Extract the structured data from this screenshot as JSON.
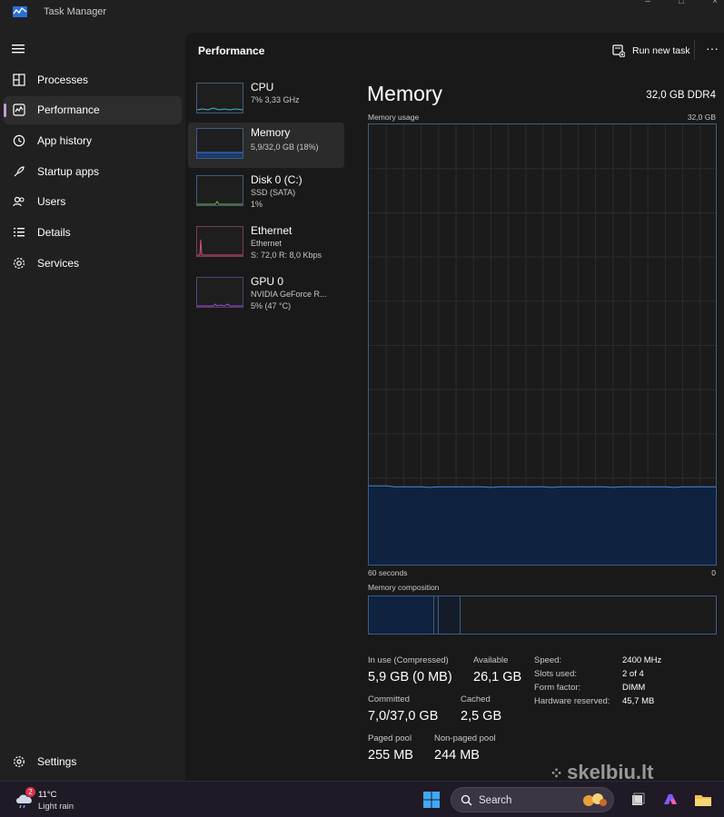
{
  "window": {
    "title": "Task Manager"
  },
  "nav": {
    "items": [
      {
        "label": "Processes",
        "icon": "processes-icon"
      },
      {
        "label": "Performance",
        "icon": "performance-icon",
        "active": true
      },
      {
        "label": "App history",
        "icon": "app-history-icon"
      },
      {
        "label": "Startup apps",
        "icon": "startup-apps-icon"
      },
      {
        "label": "Users",
        "icon": "users-icon"
      },
      {
        "label": "Details",
        "icon": "details-icon"
      },
      {
        "label": "Services",
        "icon": "services-icon"
      }
    ],
    "settings_label": "Settings"
  },
  "header": {
    "title": "Performance",
    "run_new_task": "Run new task"
  },
  "resources": [
    {
      "name": "CPU",
      "line1": "7% 3,33 GHz",
      "line2": "",
      "color": "#3fb6d4"
    },
    {
      "name": "Memory",
      "line1": "5,9/32,0 GB (18%)",
      "line2": "",
      "color": "#3f7fd4",
      "active": true
    },
    {
      "name": "Disk 0 (C:)",
      "line1": "SSD (SATA)",
      "line2": "1%",
      "color": "#7fb83f"
    },
    {
      "name": "Ethernet",
      "line1": "Ethernet",
      "line2": "S: 72,0 R: 8,0 Kbps",
      "color": "#d44f7a"
    },
    {
      "name": "GPU 0",
      "line1": "NVIDIA GeForce R...",
      "line2": "5% (47 °C)",
      "color": "#a04fd4"
    }
  ],
  "detail": {
    "title": "Memory",
    "spec": "32,0 GB DDR4",
    "usage_label": "Memory usage",
    "usage_max": "32,0 GB",
    "time_label": "60 seconds",
    "time_end": "0",
    "composition_label": "Memory composition",
    "usage_fraction": 0.18,
    "stats": {
      "in_use_label": "In use (Compressed)",
      "in_use_value": "5,9 GB (0 MB)",
      "available_label": "Available",
      "available_value": "26,1 GB",
      "committed_label": "Committed",
      "committed_value": "7,0/37,0 GB",
      "cached_label": "Cached",
      "cached_value": "2,5 GB",
      "paged_label": "Paged pool",
      "paged_value": "255 MB",
      "nonpaged_label": "Non-paged pool",
      "nonpaged_value": "244 MB"
    },
    "specs": [
      {
        "key": "Speed:",
        "value": "2400 MHz"
      },
      {
        "key": "Slots used:",
        "value": "2 of 4"
      },
      {
        "key": "Form factor:",
        "value": "DIMM"
      },
      {
        "key": "Hardware reserved:",
        "value": "45,7 MB"
      }
    ]
  },
  "taskbar": {
    "weather_temp": "11°C",
    "weather_desc": "Light rain",
    "weather_badge": "2",
    "search_placeholder": "Search"
  },
  "watermark": "skelbiu.lt"
}
